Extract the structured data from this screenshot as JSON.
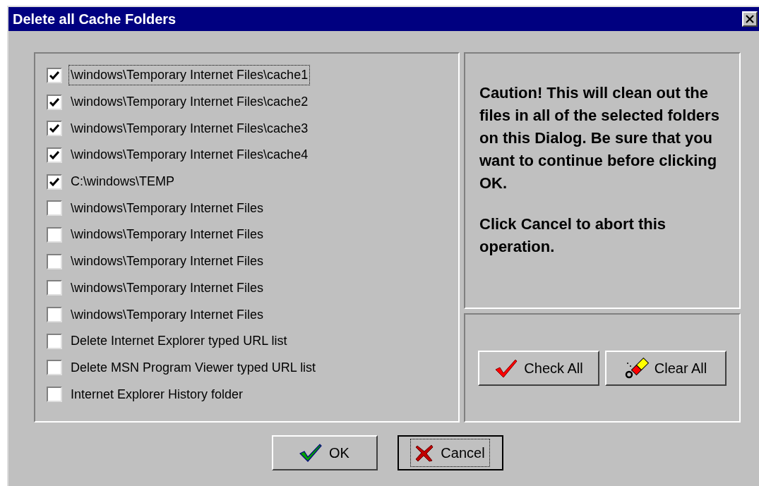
{
  "window": {
    "title": "Delete all Cache Folders"
  },
  "folders": [
    {
      "label": "\\windows\\Temporary Internet Files\\cache1",
      "checked": true,
      "focused": true
    },
    {
      "label": "\\windows\\Temporary Internet Files\\cache2",
      "checked": true,
      "focused": false
    },
    {
      "label": "\\windows\\Temporary Internet Files\\cache3",
      "checked": true,
      "focused": false
    },
    {
      "label": "\\windows\\Temporary Internet Files\\cache4",
      "checked": true,
      "focused": false
    },
    {
      "label": "C:\\windows\\TEMP",
      "checked": true,
      "focused": false
    },
    {
      "label": "\\windows\\Temporary Internet Files",
      "checked": false,
      "focused": false
    },
    {
      "label": "\\windows\\Temporary Internet Files",
      "checked": false,
      "focused": false
    },
    {
      "label": "\\windows\\Temporary Internet Files",
      "checked": false,
      "focused": false
    },
    {
      "label": "\\windows\\Temporary Internet Files",
      "checked": false,
      "focused": false
    },
    {
      "label": "\\windows\\Temporary Internet Files",
      "checked": false,
      "focused": false
    },
    {
      "label": "Delete Internet Explorer typed URL list",
      "checked": false,
      "focused": false
    },
    {
      "label": "Delete MSN Program Viewer typed URL list",
      "checked": false,
      "focused": false
    },
    {
      "label": "Internet Explorer History folder",
      "checked": false,
      "focused": false
    }
  ],
  "caution": [
    "Caution!  This will clean out the files in all of the selected folders on this Dialog. Be sure that you want to continue before clicking OK.",
    "Click Cancel to abort this operation."
  ],
  "side_buttons": [
    {
      "kind": "check",
      "label": "Check All"
    },
    {
      "kind": "clear",
      "label": "Clear All"
    }
  ],
  "buttons": [
    {
      "kind": "ok",
      "label": "OK",
      "default": false
    },
    {
      "kind": "cancel",
      "label": "Cancel",
      "default": true
    }
  ]
}
